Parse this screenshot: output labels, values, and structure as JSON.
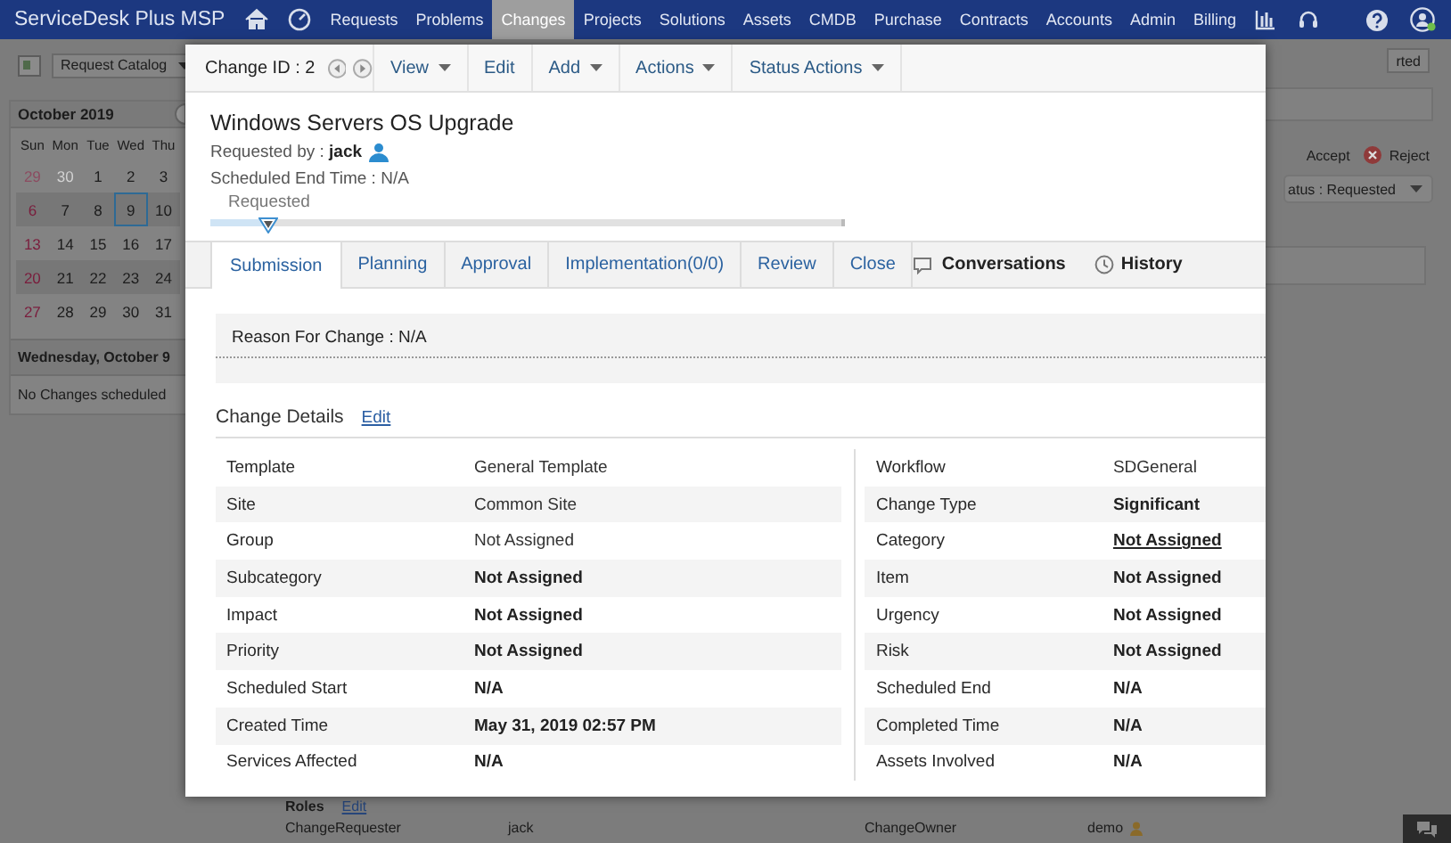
{
  "nav": {
    "logo": "ServiceDesk Plus MSP",
    "items": [
      {
        "label": "Requests",
        "selected": false
      },
      {
        "label": "Problems",
        "selected": false
      },
      {
        "label": "Changes",
        "selected": true
      },
      {
        "label": "Projects",
        "selected": false
      },
      {
        "label": "Solutions",
        "selected": false
      },
      {
        "label": "Assets",
        "selected": false
      },
      {
        "label": "CMDB",
        "selected": false
      },
      {
        "label": "Purchase",
        "selected": false
      },
      {
        "label": "Contracts",
        "selected": false
      },
      {
        "label": "Accounts",
        "selected": false
      },
      {
        "label": "Admin",
        "selected": false
      },
      {
        "label": "Billing",
        "selected": false
      }
    ]
  },
  "background": {
    "catalog_button": "Request Catalog",
    "calendar": {
      "title": "October 2019",
      "weekdays": [
        "Sun",
        "Mon",
        "Tue",
        "Wed",
        "Thu"
      ],
      "weeks": [
        [
          {
            "day": "29",
            "other_month": true,
            "selected": false
          },
          {
            "day": "30",
            "other_month": true,
            "selected": false
          },
          {
            "day": "1",
            "other_month": false,
            "selected": false
          },
          {
            "day": "2",
            "other_month": false,
            "selected": false
          },
          {
            "day": "3",
            "other_month": false,
            "selected": false
          }
        ],
        [
          {
            "day": "6",
            "other_month": false,
            "selected": false
          },
          {
            "day": "7",
            "other_month": false,
            "selected": false
          },
          {
            "day": "8",
            "other_month": false,
            "selected": false
          },
          {
            "day": "9",
            "other_month": false,
            "selected": true
          },
          {
            "day": "10",
            "other_month": false,
            "selected": false
          }
        ],
        [
          {
            "day": "13",
            "other_month": false,
            "selected": false
          },
          {
            "day": "14",
            "other_month": false,
            "selected": false
          },
          {
            "day": "15",
            "other_month": false,
            "selected": false
          },
          {
            "day": "16",
            "other_month": false,
            "selected": false
          },
          {
            "day": "17",
            "other_month": false,
            "selected": false
          }
        ],
        [
          {
            "day": "20",
            "other_month": false,
            "selected": false
          },
          {
            "day": "21",
            "other_month": false,
            "selected": false
          },
          {
            "day": "22",
            "other_month": false,
            "selected": false
          },
          {
            "day": "23",
            "other_month": false,
            "selected": false
          },
          {
            "day": "24",
            "other_month": false,
            "selected": false
          }
        ],
        [
          {
            "day": "27",
            "other_month": false,
            "selected": false
          },
          {
            "day": "28",
            "other_month": false,
            "selected": false
          },
          {
            "day": "29",
            "other_month": false,
            "selected": false
          },
          {
            "day": "30",
            "other_month": false,
            "selected": false
          },
          {
            "day": "31",
            "other_month": false,
            "selected": false
          }
        ]
      ],
      "day_title": "Wednesday, October 9",
      "day_empty": "No Changes scheduled"
    },
    "right": {
      "button": "rted",
      "accept": "Accept",
      "reject": "Reject",
      "status": "atus : Requested"
    },
    "roles": {
      "title": "Roles",
      "edit": "Edit",
      "rows": [
        {
          "label": "ChangeRequester",
          "value": "jack"
        },
        {
          "label": "ChangeOwner",
          "value": "demo"
        }
      ]
    }
  },
  "modal": {
    "change_id": "Change ID : 2",
    "toolbar": [
      {
        "label": "View",
        "dropdown": true
      },
      {
        "label": "Edit",
        "dropdown": false
      },
      {
        "label": "Add",
        "dropdown": true
      },
      {
        "label": "Actions",
        "dropdown": true
      },
      {
        "label": "Status Actions",
        "dropdown": true
      }
    ],
    "title": "Windows Servers OS Upgrade",
    "requested_by": "Requested by : **jack**",
    "scheduled_end": "Scheduled End Time : N/A",
    "stage": {
      "label": "Requested",
      "level": 0.09
    },
    "tabs": [
      {
        "label": "Submission",
        "selected": true
      },
      {
        "label": "Planning",
        "selected": false
      },
      {
        "label": "Approval",
        "selected": false
      },
      {
        "label": "Implementation(0/0)",
        "selected": false
      },
      {
        "label": "Review",
        "selected": false
      },
      {
        "label": "Close",
        "selected": false
      }
    ],
    "side_tabs": [
      {
        "label": "Conversations",
        "kind": "chat"
      },
      {
        "label": "History",
        "kind": "history"
      }
    ],
    "reason": "Reason For Change : N/A",
    "details": {
      "title": "Change Details",
      "edit": "Edit",
      "left": [
        {
          "label": "Template",
          "value": "General Template",
          "bold": false,
          "kind": "text"
        },
        {
          "label": "Site",
          "value": "Common Site",
          "bold": false,
          "kind": "text"
        },
        {
          "label": "Group",
          "value": "Not Assigned",
          "bold": false,
          "kind": "text"
        },
        {
          "label": "Subcategory",
          "value": "Not Assigned",
          "bold": true,
          "kind": "text"
        },
        {
          "label": "Impact",
          "value": "Not Assigned",
          "bold": true,
          "kind": "text"
        },
        {
          "label": "Priority",
          "value": "Not Assigned",
          "bold": true,
          "kind": "text"
        },
        {
          "label": "Scheduled Start",
          "value": "N/A",
          "bold": true,
          "kind": "text"
        },
        {
          "label": "Created Time",
          "value": "May 31, 2019 02:57 PM",
          "bold": true,
          "kind": "text"
        },
        {
          "label": "Services Affected",
          "value": "N/A",
          "bold": true,
          "kind": "text"
        }
      ],
      "right": [
        {
          "label": "Workflow",
          "value": "SDGeneral",
          "bold": false,
          "kind": "text"
        },
        {
          "label": "Change Type",
          "value": "Significant",
          "bold": true,
          "kind": "text"
        },
        {
          "label": "Category",
          "value": "Not Assigned",
          "bold": true,
          "kind": "link"
        },
        {
          "label": "Item",
          "value": "Not Assigned",
          "bold": true,
          "kind": "text"
        },
        {
          "label": "Urgency",
          "value": "Not Assigned",
          "bold": true,
          "kind": "text"
        },
        {
          "label": "Risk",
          "value": "Not Assigned",
          "bold": true,
          "kind": "text"
        },
        {
          "label": "Scheduled End",
          "value": "N/A",
          "bold": true,
          "kind": "text"
        },
        {
          "label": "Completed Time",
          "value": "N/A",
          "bold": true,
          "kind": "text"
        },
        {
          "label": "Assets Involved",
          "value": "N/A",
          "bold": true,
          "kind": "text"
        }
      ]
    }
  }
}
